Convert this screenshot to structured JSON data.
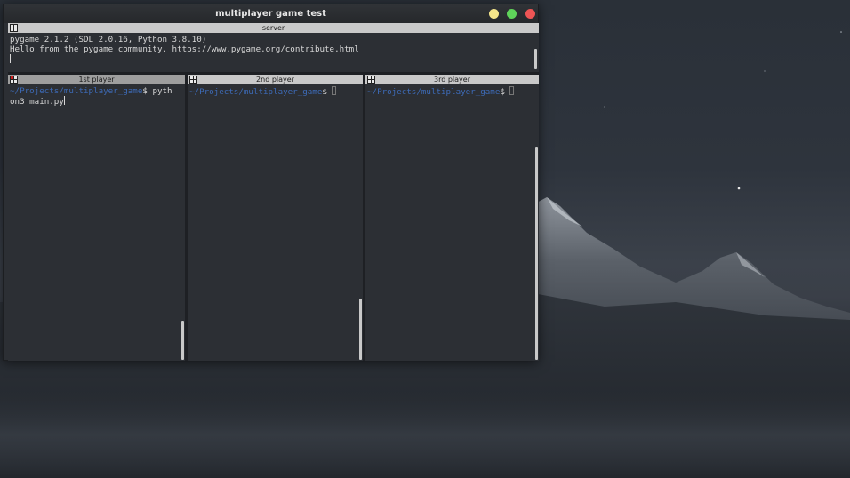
{
  "window": {
    "title": "multiplayer game test"
  },
  "server_pane": {
    "header": "server",
    "lines": [
      "pygame 2.1.2 (SDL 2.0.16, Python 3.8.10)",
      "Hello from the pygame community. https://www.pygame.org/contribute.html"
    ]
  },
  "player1_pane": {
    "header": "1st player",
    "prompt_path": "~/Projects/multiplayer_game",
    "prompt_symbol": "$",
    "command_line1": " pyth",
    "command_line2": "on3 main.py"
  },
  "player2_pane": {
    "header": "2nd player",
    "prompt_path": "~/Projects/multiplayer_game",
    "prompt_symbol": "$"
  },
  "player3_pane": {
    "header": "3rd player",
    "prompt_path": "~/Projects/multiplayer_game",
    "prompt_symbol": "$"
  },
  "icons": {
    "minimize": "minimize-icon",
    "maximize": "maximize-icon",
    "close": "close-icon",
    "pane": "terminal-pane-icon"
  },
  "colors": {
    "prompt_path": "#3d6bb8",
    "terminal_bg": "#2c2f34",
    "pane_header": "#c9c9c9",
    "active_pane_header": "#9e9e9e",
    "close_button": "#ee5555",
    "maximize_button": "#5fd35a",
    "minimize_button": "#f4e58a"
  }
}
